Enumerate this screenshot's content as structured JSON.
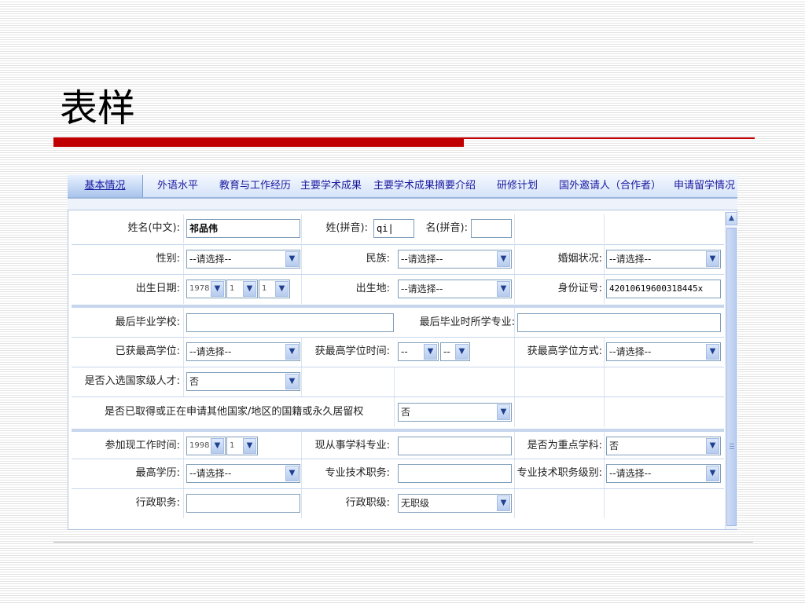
{
  "slide": {
    "title": "表样"
  },
  "tabs": [
    "基本情况",
    "外语水平",
    "教育与工作经历",
    "主要学术成果",
    "主要学术成果摘要介绍",
    "研修计划",
    "国外邀请人（合作者）",
    "申请留学情况"
  ],
  "form": {
    "name_cn": {
      "label": "姓名(中文):",
      "value": "祁品伟"
    },
    "surname_py": {
      "label": "姓(拼音):",
      "value": "qi|"
    },
    "given_py": {
      "label": "名(拼音):",
      "value": ""
    },
    "gender": {
      "label": "性别:",
      "value": "--请选择--"
    },
    "ethnicity": {
      "label": "民族:",
      "value": "--请选择--"
    },
    "marital": {
      "label": "婚姻状况:",
      "value": "--请选择--"
    },
    "birth_date": {
      "label": "出生日期:",
      "year": "1978",
      "month": "1",
      "day": "1"
    },
    "birthplace": {
      "label": "出生地:",
      "value": "--请选择--"
    },
    "id_number": {
      "label": "身份证号:",
      "value": "42010619600318445x"
    },
    "last_school": {
      "label": "最后毕业学校:",
      "value": ""
    },
    "last_major": {
      "label": "最后毕业时所学专业:",
      "value": ""
    },
    "highest_degree": {
      "label": "已获最高学位:",
      "value": "--请选择--"
    },
    "degree_time": {
      "label": "获最高学位时间:",
      "year": "--",
      "month": "--"
    },
    "degree_method": {
      "label": "获最高学位方式:",
      "value": "--请选择--"
    },
    "national_talent": {
      "label": "是否入选国家级人才:",
      "value": "否"
    },
    "foreign_residency": {
      "label": "是否已取得或正在申请其他国家/地区的国籍或永久居留权",
      "value": "否"
    },
    "work_start": {
      "label": "参加现工作时间:",
      "year": "1998",
      "month": "1"
    },
    "current_field": {
      "label": "现从事学科专业:",
      "value": ""
    },
    "key_discipline": {
      "label": "是否为重点学科:",
      "value": "否"
    },
    "education": {
      "label": "最高学历:",
      "value": "--请选择--"
    },
    "tech_title": {
      "label": "专业技术职务:",
      "value": ""
    },
    "tech_level": {
      "label": "专业技术职务级别:",
      "value": "--请选择--"
    },
    "admin_post": {
      "label": "行政职务:",
      "value": ""
    },
    "admin_level": {
      "label": "行政职级:",
      "value": "无职级"
    }
  },
  "icons": {
    "dropdown": "chevron-down-icon",
    "scroll_up": "scroll-up-arrow-icon"
  }
}
